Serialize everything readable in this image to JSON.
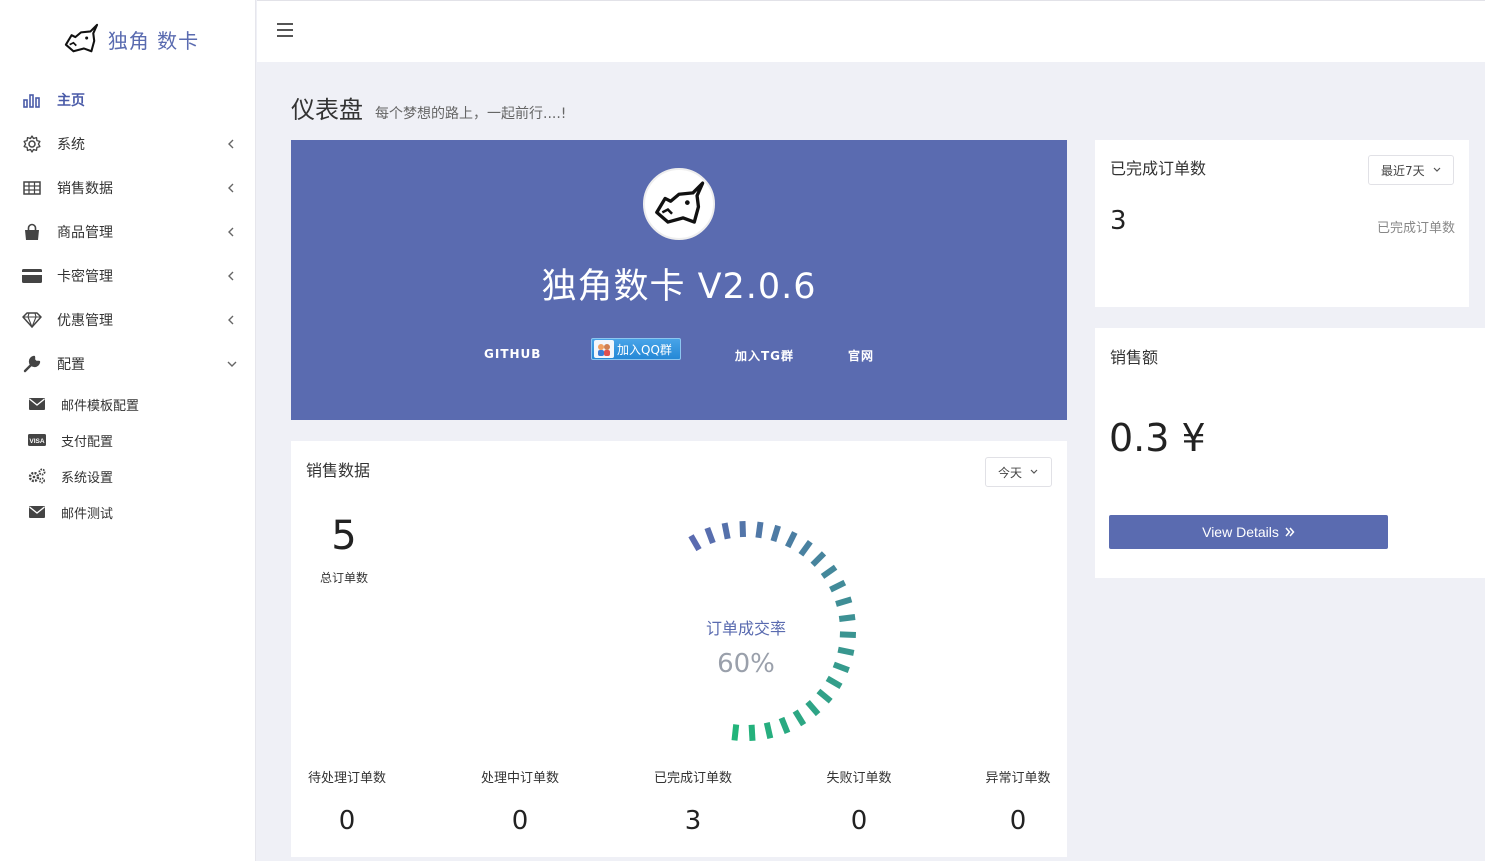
{
  "brand": {
    "name": "独角 数卡"
  },
  "sidebar": {
    "items": [
      {
        "label": "主页",
        "icon": "bar-chart-icon"
      },
      {
        "label": "系统",
        "icon": "gear-icon"
      },
      {
        "label": "销售数据",
        "icon": "table-icon"
      },
      {
        "label": "商品管理",
        "icon": "shopping-bag-icon"
      },
      {
        "label": "卡密管理",
        "icon": "credit-card-icon"
      },
      {
        "label": "优惠管理",
        "icon": "diamond-icon"
      },
      {
        "label": "配置",
        "icon": "wrench-icon"
      }
    ],
    "sub_items": [
      {
        "label": "邮件模板配置",
        "icon": "envelope-icon"
      },
      {
        "label": "支付配置",
        "icon": "visa-icon"
      },
      {
        "label": "系统设置",
        "icon": "gears-icon"
      },
      {
        "label": "邮件测试",
        "icon": "envelope-icon"
      }
    ]
  },
  "page": {
    "title": "仪表盘",
    "subtitle": "每个梦想的路上，一起前行....!"
  },
  "hero": {
    "title": "独角数卡 V2.0.6",
    "links": {
      "github": "GITHUB",
      "qq": "加入QQ群",
      "tg": "加入TG群",
      "site": "官网"
    }
  },
  "sales": {
    "title": "销售数据",
    "period": "今天",
    "total": "5",
    "total_label": "总订单数",
    "gauge_label": "订单成交率",
    "gauge_pct": "60%",
    "gauge_value": 0.6,
    "stats": [
      {
        "label": "待处理订单数",
        "value": "0"
      },
      {
        "label": "处理中订单数",
        "value": "0"
      },
      {
        "label": "已完成订单数",
        "value": "3"
      },
      {
        "label": "失败订单数",
        "value": "0"
      },
      {
        "label": "异常订单数",
        "value": "0"
      }
    ]
  },
  "completed": {
    "title": "已完成订单数",
    "period": "最近7天",
    "value": "3",
    "label": "已完成订单数"
  },
  "revenue": {
    "title": "销售额",
    "amount": "0.3 ¥",
    "button": "View Details"
  },
  "colors": {
    "primary": "#5a6bb0",
    "gauge_start": "#22b47a",
    "gauge_end": "#5a6bb0"
  }
}
